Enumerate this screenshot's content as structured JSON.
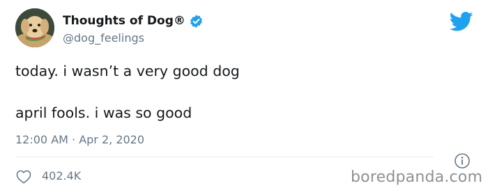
{
  "author": {
    "display_name": "Thoughts of Dog®",
    "handle": "@dog_feelings",
    "verified": true,
    "avatar_icon": "dog-avatar"
  },
  "tweet": {
    "lines": [
      "today. i wasn’t a very good dog",
      "april fools. i was so good"
    ],
    "timestamp": "12:00 AM · Apr 2, 2020"
  },
  "stats": {
    "likes": "402.4K"
  },
  "icons": {
    "brand": "twitter-bird-icon",
    "verified": "verified-badge-icon",
    "info": "info-icon",
    "like": "heart-icon"
  },
  "colors": {
    "twitter_blue": "#1da1f2",
    "secondary_text": "#657786",
    "watermark": "#909090"
  },
  "watermark": "boredpanda.com"
}
